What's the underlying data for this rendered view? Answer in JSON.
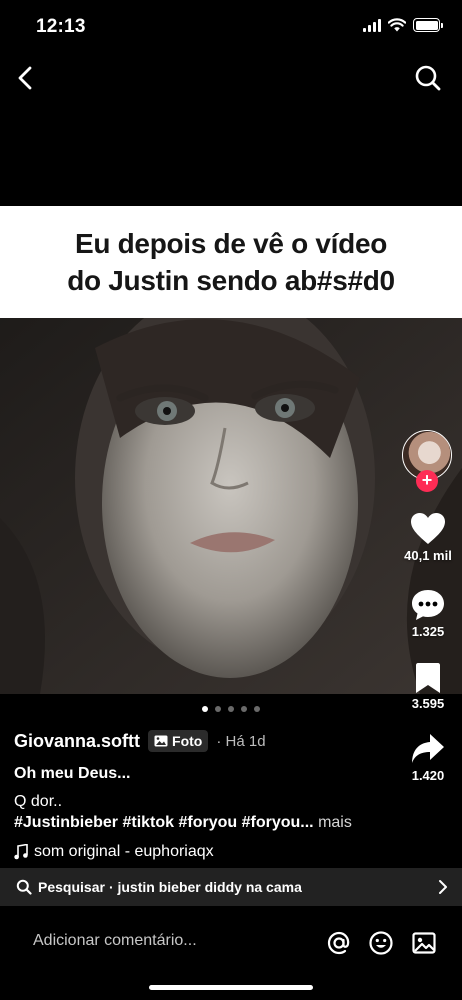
{
  "status_bar": {
    "time": "12:13"
  },
  "nav": {
    "back_icon": "chevron-left-icon",
    "search_icon": "search-icon"
  },
  "caption": {
    "line1": "Eu depois de vê o vídeo",
    "line2": "do Justin sendo ab#s#d0"
  },
  "actions": {
    "likes": "40,1 mil",
    "comments": "1.325",
    "saves": "3.595",
    "shares": "1.420"
  },
  "pager": {
    "total": 5,
    "active_index": 0
  },
  "post": {
    "author": "Giovanna.softt",
    "badge": "Foto",
    "time_ago": "· Há 1d",
    "title": "Oh meu Deus...",
    "description": "Q dor..",
    "hashtags": "#Justinbieber #tiktok #foryou #foryou...",
    "more_label": "mais",
    "music": "som original - euphoriaqx"
  },
  "search_suggestion": {
    "prefix": "Pesquisar",
    "query": "· justin bieber diddy na cama"
  },
  "comment_bar": {
    "placeholder": "Adicionar comentário..."
  },
  "colors": {
    "accent": "#fe2c55",
    "caption_bg": "#ffffff",
    "background": "#000000"
  }
}
